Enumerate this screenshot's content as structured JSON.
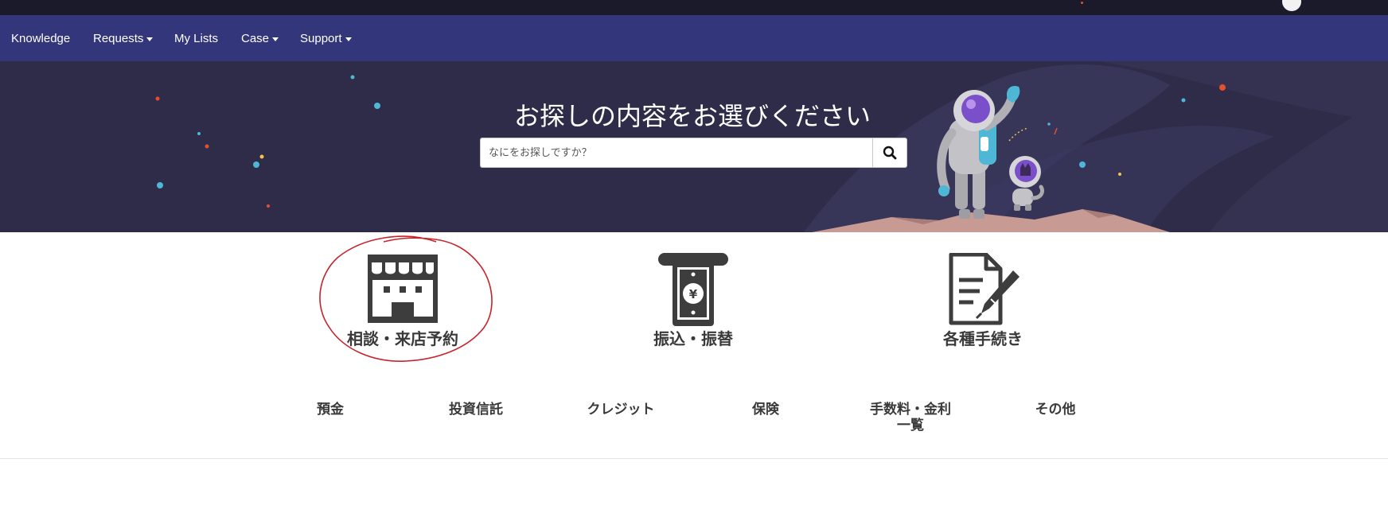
{
  "nav": {
    "items": [
      {
        "label": "Knowledge",
        "dropdown": false
      },
      {
        "label": "Requests",
        "dropdown": true
      },
      {
        "label": "My Lists",
        "dropdown": false
      },
      {
        "label": "Case",
        "dropdown": true
      },
      {
        "label": "Support",
        "dropdown": true
      }
    ]
  },
  "hero": {
    "title": "お探しの内容をお選びください",
    "search_placeholder": "なにをお探しですか？",
    "search_icon": "magnifying-glass-icon"
  },
  "tiles": [
    {
      "label": "相談・来店予約",
      "icon": "storefront-icon"
    },
    {
      "label": "振込・振替",
      "icon": "banknote-dispenser-icon"
    },
    {
      "label": "各種手続き",
      "icon": "document-pen-icon"
    }
  ],
  "categories": [
    {
      "label": "預金"
    },
    {
      "label": "投資信託"
    },
    {
      "label": "クレジット"
    },
    {
      "label": "保険"
    },
    {
      "label": "手数料・金利一覧"
    },
    {
      "label": "その他"
    }
  ],
  "colors": {
    "topbar": "#1b1a2b",
    "navbar": "#33367a",
    "hero_bg": "#2e2c48",
    "icon_gray": "#3d3d3d",
    "annotation_red": "#c8232b"
  }
}
